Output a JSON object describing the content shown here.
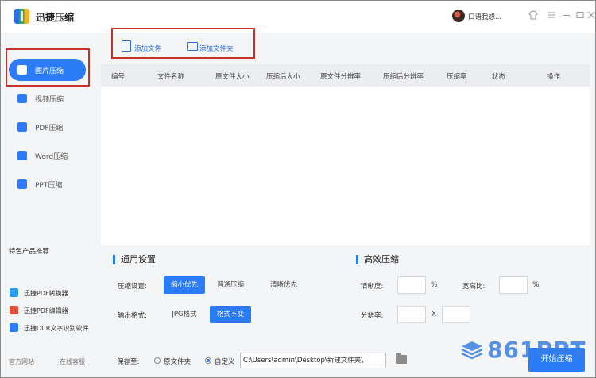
{
  "app": {
    "title": "迅捷压缩",
    "user_name": "口语我想...",
    "colors": {
      "accent": "#2b7cf6",
      "annotation_red": "#c8302a"
    }
  },
  "window_controls": [
    "skin-icon",
    "menu-icon",
    "minimize-icon",
    "maximize-icon",
    "close-icon"
  ],
  "sidebar": {
    "items": [
      {
        "label": "图片压缩",
        "icon": "image-icon",
        "active": true
      },
      {
        "label": "视频压缩",
        "icon": "video-icon",
        "active": false
      },
      {
        "label": "PDF压缩",
        "icon": "pdf-icon",
        "active": false
      },
      {
        "label": "Word压缩",
        "icon": "word-icon",
        "active": false
      },
      {
        "label": "PPT压缩",
        "icon": "ppt-icon",
        "active": false
      }
    ],
    "features_title": "特色产品推荐",
    "features": [
      {
        "label": "迅捷PDF转换器",
        "icon": "pdf-converter-icon"
      },
      {
        "label": "迅捷PDF编辑器",
        "icon": "pdf-editor-icon"
      },
      {
        "label": "迅捷OCR文字识别软件",
        "icon": "ocr-icon"
      }
    ],
    "footer": {
      "website": "官方网站",
      "support": "在线客服"
    }
  },
  "toolbar": {
    "add_file": "添加文件",
    "add_folder": "添加文件夹"
  },
  "table": {
    "columns": [
      "编号",
      "文件名称",
      "原文件大小",
      "压缩后大小",
      "原文件分辨率",
      "压缩后分辨率",
      "压缩率",
      "状态",
      "操作"
    ]
  },
  "general_settings": {
    "title": "通用设置",
    "compress_label": "压缩设置:",
    "compress_options": [
      "缩小优先",
      "普通压缩",
      "清晰优先"
    ],
    "compress_selected": "缩小优先",
    "format_label": "输出格式:",
    "format_options": [
      "JPG格式",
      "格式不变"
    ],
    "format_selected": "格式不变"
  },
  "efficient": {
    "title": "高效压缩",
    "clarity_label": "清晰度:",
    "clarity_unit": "%",
    "ratio_label": "宽高比:",
    "ratio_unit": "%",
    "resolution_label": "分辨率:",
    "resolution_sep": "X"
  },
  "save": {
    "label": "保存至:",
    "options": [
      "原文件夹",
      "自定义"
    ],
    "selected": "自定义",
    "path": "C:\\Users\\admin\\Desktop\\新建文件夹\\"
  },
  "start_button": "开始压缩",
  "watermark": "861PPT"
}
